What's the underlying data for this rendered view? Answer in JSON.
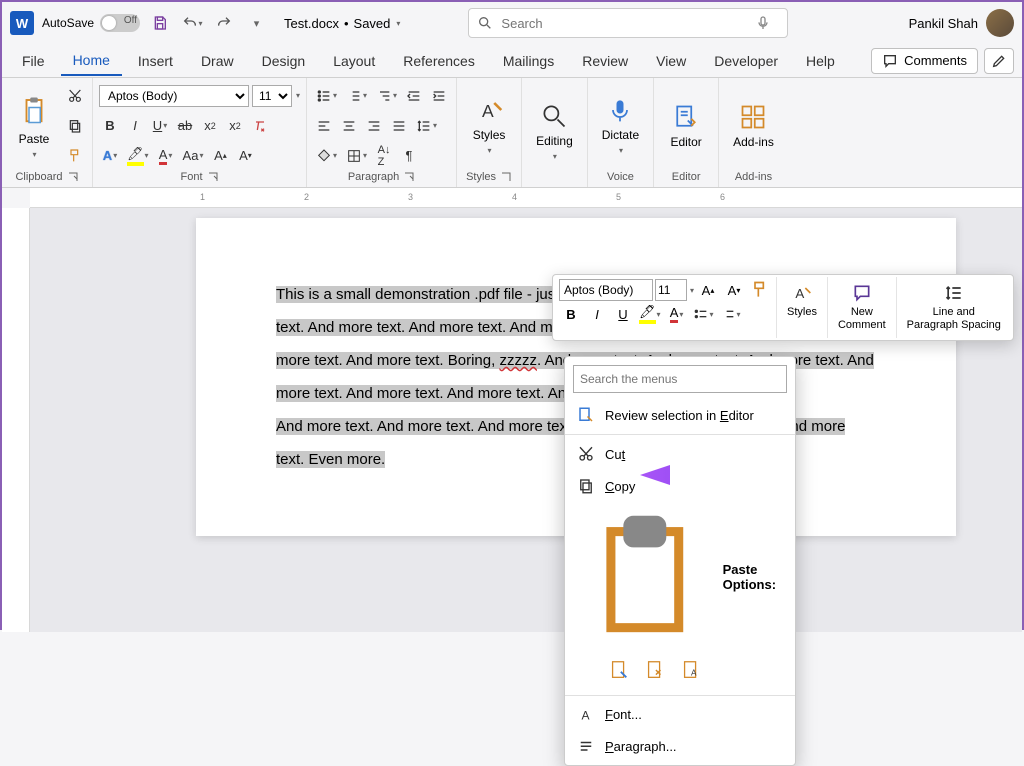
{
  "titlebar": {
    "autosave_label": "AutoSave",
    "doc_name": "Test.docx",
    "doc_status": "Saved",
    "user_name": "Pankil Shah",
    "search_placeholder": "Search"
  },
  "tabs": {
    "file": "File",
    "home": "Home",
    "insert": "Insert",
    "draw": "Draw",
    "design": "Design",
    "layout": "Layout",
    "references": "References",
    "mailings": "Mailings",
    "review": "Review",
    "view": "View",
    "developer": "Developer",
    "help": "Help",
    "comments": "Comments"
  },
  "ribbon": {
    "paste": "Paste",
    "clipboard": "Clipboard",
    "font_name": "Aptos (Body)",
    "font_size": "11",
    "font_group": "Font",
    "para_group": "Paragraph",
    "styles_btn": "Styles",
    "styles_group": "Styles",
    "editing_btn": "Editing",
    "dictate_btn": "Dictate",
    "voice_group": "Voice",
    "editor_btn": "Editor",
    "editor_group": "Editor",
    "addins_btn": "Add-ins",
    "addins_group": "Add-ins"
  },
  "mini": {
    "font_name": "Aptos (Body)",
    "font_size": "11",
    "styles": "Styles",
    "new_comment": "New Comment",
    "spacing": "Line and Paragraph Spacing"
  },
  "context": {
    "search_placeholder": "Search the menus",
    "review": "Review selection in ",
    "review_editor": "Editor",
    "cut": "Cut",
    "copy": "Copy",
    "paste_options": "Paste Options:",
    "font": "Font...",
    "paragraph": "Paragraph..."
  },
  "document": {
    "text": "This is a small demonstration .pdf file - just for use in the Virtual Mechanics tutorials. More text. And more text. And more text. And more text. And more text. And more text. And more text. And more text. Boring, zzzzz. And more text. And more text. And more text. And more text. And more text. And more text. And more text. And more text. And more text. And more text. And more text. And more text. And more text. And more text. Even more."
  },
  "ruler_ticks": [
    "1",
    "2",
    "3",
    "4",
    "5",
    "6"
  ]
}
